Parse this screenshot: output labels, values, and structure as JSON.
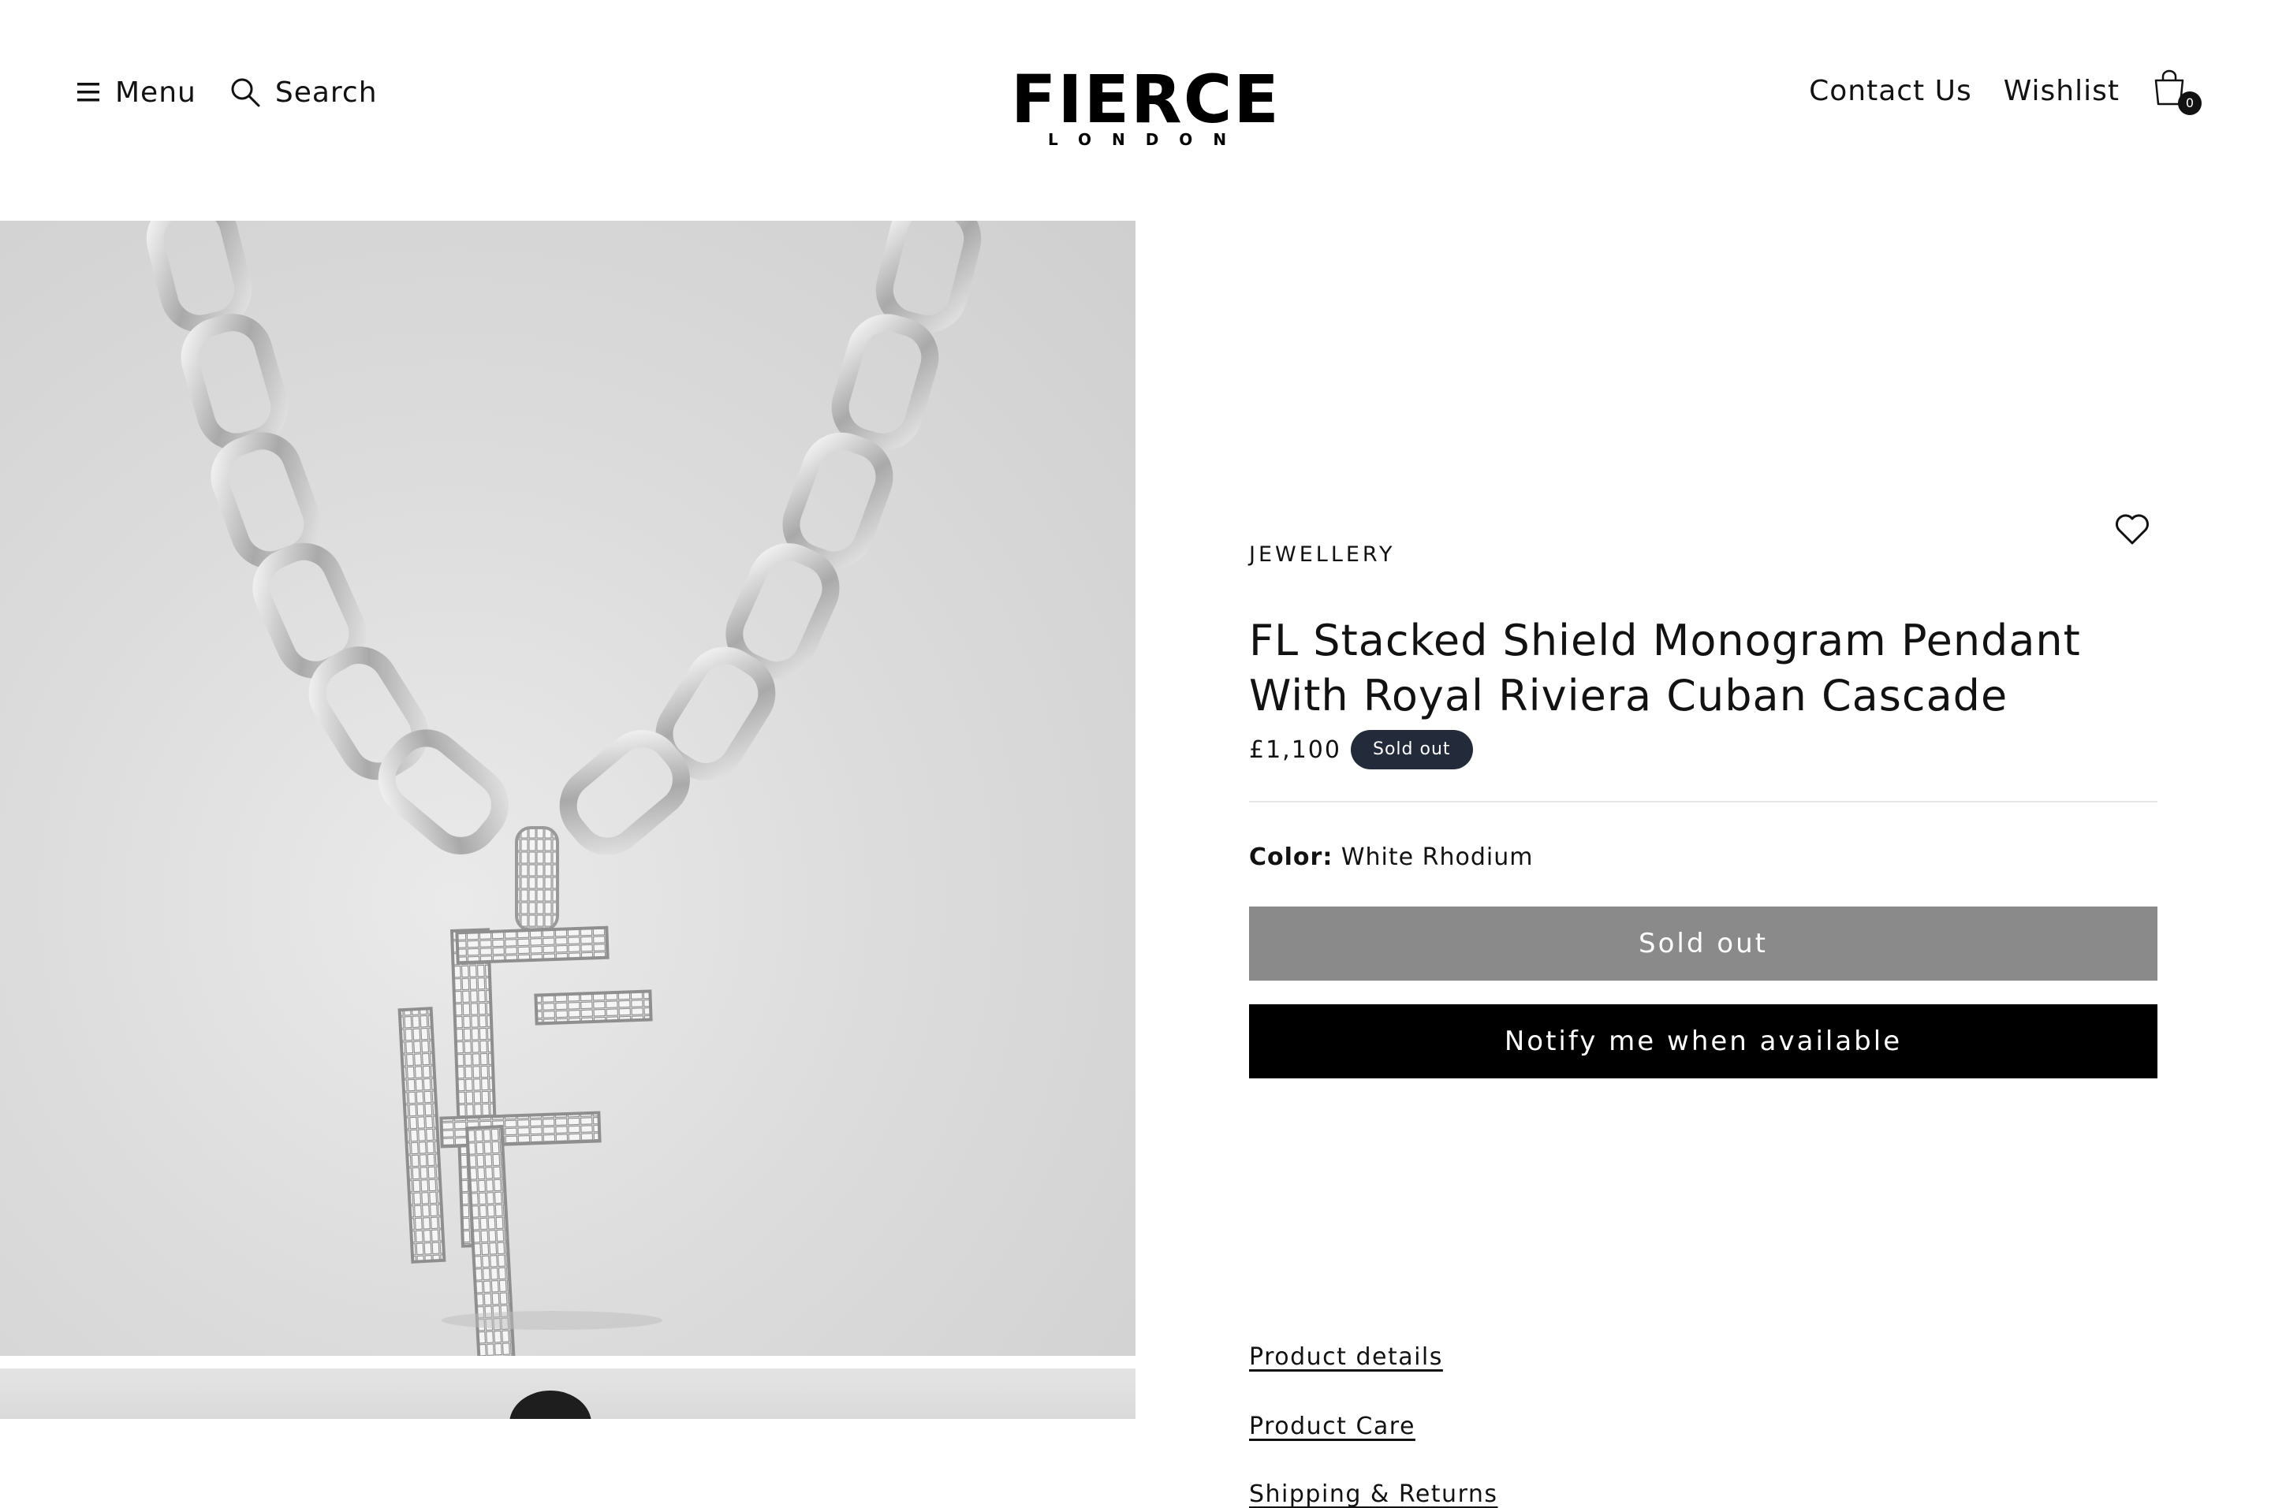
{
  "header": {
    "menu_label": "Menu",
    "search_label": "Search",
    "logo_main": "FIERCE",
    "logo_sub": "LONDON",
    "contact_label": "Contact Us",
    "wishlist_label": "Wishlist",
    "cart_count": "0"
  },
  "product": {
    "vendor": "JEWELLERY",
    "title": "FL Stacked Shield Monogram Pendant With Royal Riviera Cuban Cascade",
    "price": "£1,100",
    "badge": "Sold out",
    "color_label": "Color:",
    "color_value": "White Rhodium",
    "soldout_button": "Sold out",
    "notify_button": "Notify me when available",
    "accordions": [
      "Product details",
      "Product Care",
      "Shipping & Returns"
    ]
  },
  "colors": {
    "badge_bg": "#232a3a",
    "soldout_button_bg": "#8a8a8a",
    "notify_button_bg": "#000000",
    "text": "#121212"
  },
  "icons": {
    "menu": "menu-icon",
    "search": "search-icon",
    "cart": "cart-icon",
    "heart": "heart-icon"
  }
}
